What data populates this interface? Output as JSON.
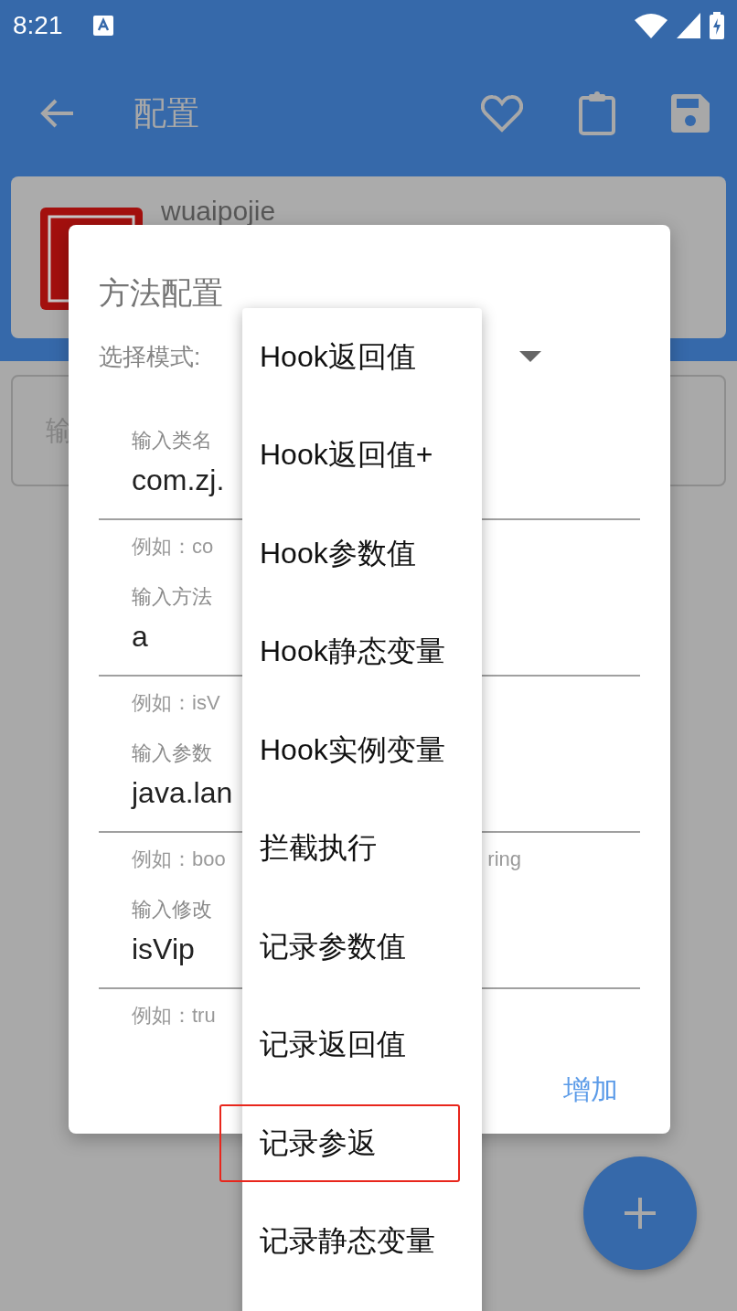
{
  "status_bar": {
    "time": "8:21"
  },
  "toolbar": {
    "title": "配置"
  },
  "card": {
    "name": "wuaipojie"
  },
  "search_field": {
    "placeholder": "输"
  },
  "dialog": {
    "title": "方法配置",
    "mode_label": "选择模式:",
    "fields": [
      {
        "label": "输入类名",
        "value": "com.zj.",
        "hint": "例如：co"
      },
      {
        "label": "输入方法",
        "value": "a",
        "hint": "例如：isV"
      },
      {
        "label": "输入参数",
        "value": "java.lan",
        "hint": "例如：boo",
        "hint_tail": "ring"
      },
      {
        "label": "输入修改",
        "value": "isVip",
        "hint": "例如：tru"
      }
    ],
    "button": "增加"
  },
  "menu": {
    "items": [
      {
        "label": "Hook返回值",
        "highlighted": false
      },
      {
        "label": "Hook返回值+",
        "highlighted": false
      },
      {
        "label": "Hook参数值",
        "highlighted": false
      },
      {
        "label": "Hook静态变量",
        "highlighted": false
      },
      {
        "label": "Hook实例变量",
        "highlighted": false
      },
      {
        "label": "拦截执行",
        "highlighted": false
      },
      {
        "label": "记录参数值",
        "highlighted": false
      },
      {
        "label": "记录返回值",
        "highlighted": false
      },
      {
        "label": "记录参返",
        "highlighted": true
      },
      {
        "label": "记录静态变量",
        "highlighted": false
      }
    ]
  }
}
